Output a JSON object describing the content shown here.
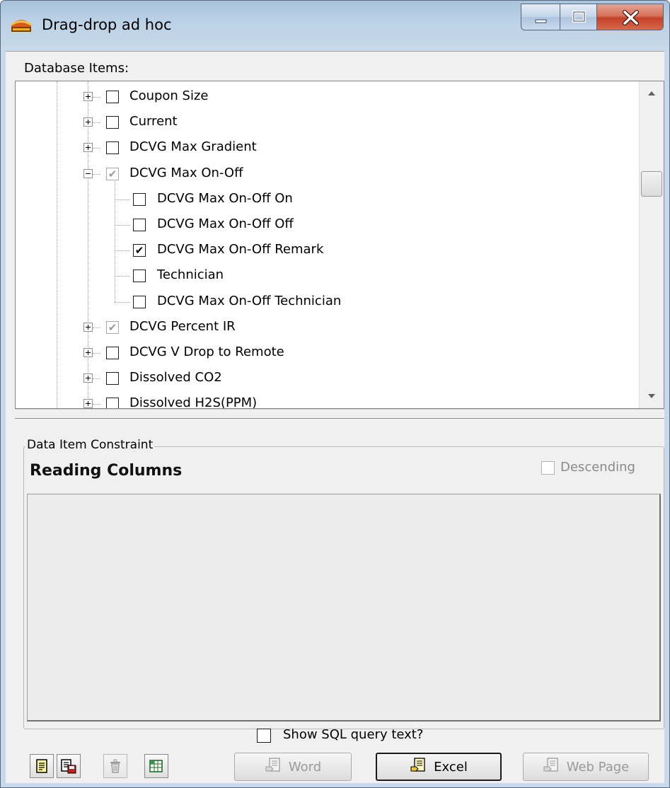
{
  "window": {
    "title": "Drag-drop ad hoc"
  },
  "tree": {
    "label": "Database Items:",
    "items": [
      {
        "label": "Coupon Size",
        "level": 1,
        "expanded": false,
        "checked": "unchecked"
      },
      {
        "label": "Current",
        "level": 1,
        "expanded": false,
        "checked": "unchecked"
      },
      {
        "label": "DCVG Max Gradient",
        "level": 1,
        "expanded": false,
        "checked": "unchecked"
      },
      {
        "label": "DCVG Max On-Off",
        "level": 1,
        "expanded": true,
        "checked": "partial"
      },
      {
        "label": "DCVG Max On-Off On",
        "level": 2,
        "checked": "unchecked"
      },
      {
        "label": "DCVG Max On-Off Off",
        "level": 2,
        "checked": "unchecked"
      },
      {
        "label": "DCVG Max On-Off Remark",
        "level": 2,
        "checked": "checked"
      },
      {
        "label": "Technician",
        "level": 2,
        "checked": "unchecked"
      },
      {
        "label": "DCVG Max On-Off Technician",
        "level": 2,
        "checked": "unchecked"
      },
      {
        "label": "DCVG Percent IR",
        "level": 1,
        "expanded": false,
        "checked": "partial"
      },
      {
        "label": "DCVG V Drop to Remote",
        "level": 1,
        "expanded": false,
        "checked": "unchecked"
      },
      {
        "label": "Dissolved CO2",
        "level": 1,
        "expanded": false,
        "checked": "unchecked"
      },
      {
        "label": "Dissolved H2S(PPM)",
        "level": 1,
        "expanded": false,
        "checked": "unchecked"
      }
    ]
  },
  "constraint": {
    "group_label": "Data Item Constraint",
    "title": "Reading Columns",
    "descending_label": "Descending",
    "descending_checked": false
  },
  "sql": {
    "label": "Show SQL query text?",
    "checked": false
  },
  "buttons": {
    "word_label": "Word",
    "excel_label": "Excel",
    "webpage_label": "Web Page"
  },
  "toolbar_icons": [
    "new-report-icon",
    "save-report-icon",
    "trash-icon",
    "excel-sheet-icon"
  ]
}
